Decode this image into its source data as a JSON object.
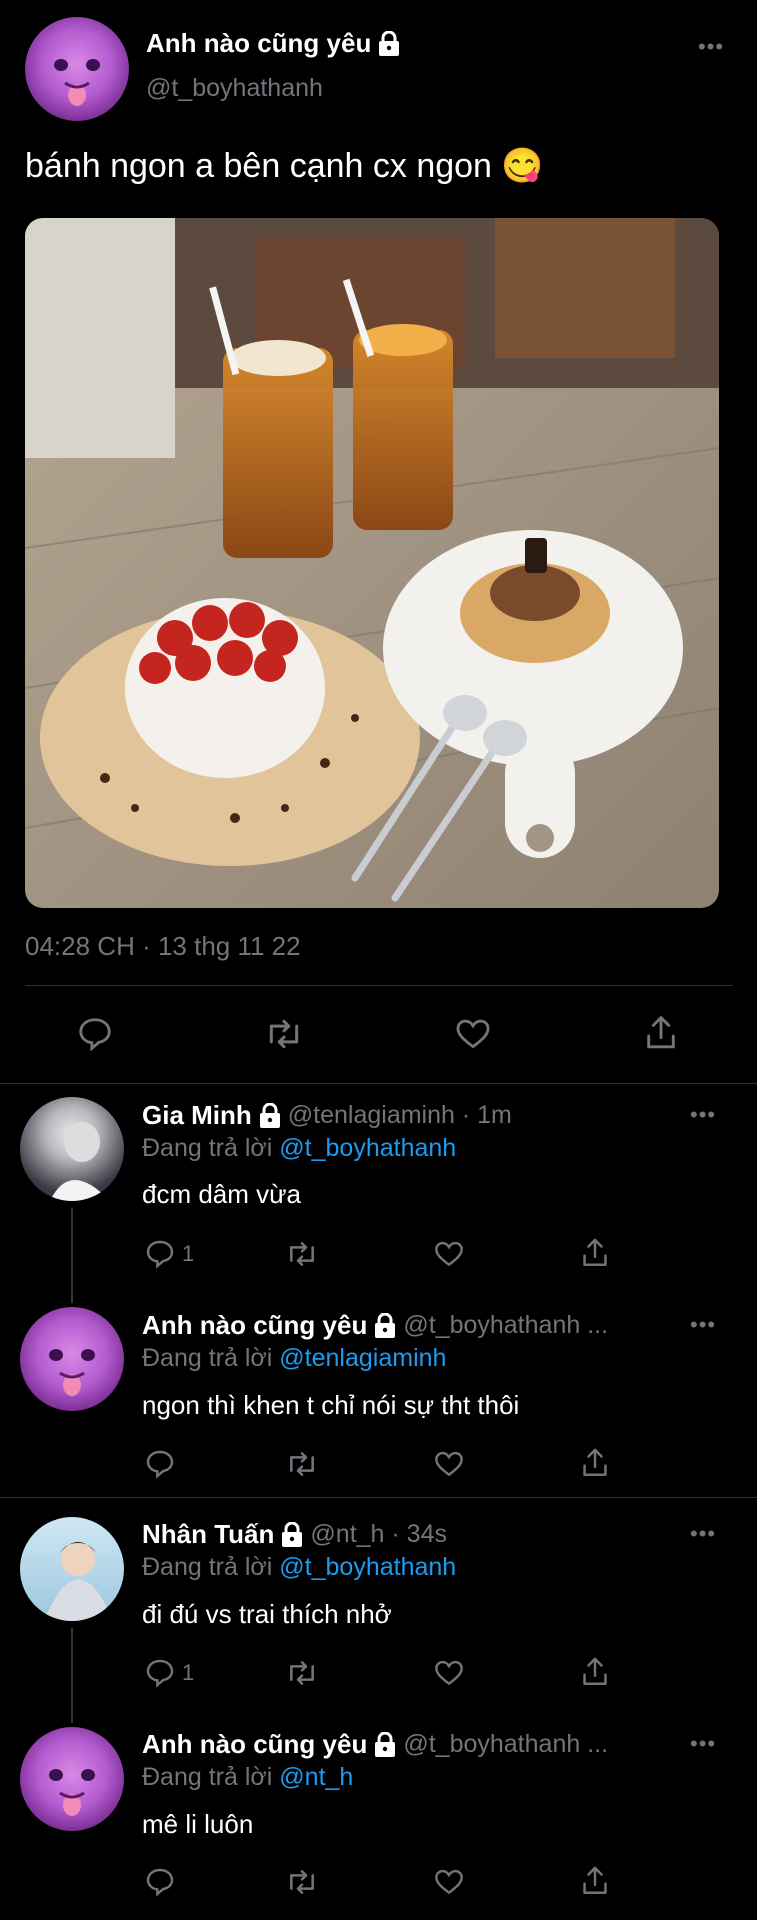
{
  "main_tweet": {
    "display_name": "Anh nào cũng yêu",
    "handle": "@t_boyhathanh",
    "text": "bánh ngon a bên cạnh cx ngon 😋",
    "timestamp": "04:28 CH · 13 thg 11 22",
    "icons": [
      "reply-icon",
      "retweet-icon",
      "like-icon",
      "share-icon"
    ]
  },
  "replies": [
    {
      "display_name": "Gia Minh",
      "handle": "@tenlagiaminh · 1m",
      "replying_prefix": "Đang trả lời",
      "replying_to": "@t_boyhathanh",
      "text": "đcm dâm vừa",
      "reply_count": "1"
    },
    {
      "display_name": "Anh nào cũng yêu",
      "handle": "@t_boyhathanh ...",
      "replying_prefix": "Đang trả lời",
      "replying_to": "@tenlagiaminh",
      "text": "ngon thì khen t chỉ nói sự tht thôi",
      "reply_count": ""
    },
    {
      "display_name": "Nhân Tuấn",
      "handle": "@nt_h · 34s",
      "replying_prefix": "Đang trả lời",
      "replying_to": "@t_boyhathanh",
      "text": "đi đú vs trai thích nhở",
      "reply_count": "1"
    },
    {
      "display_name": "Anh nào cũng yêu",
      "handle": "@t_boyhathanh ...",
      "replying_prefix": "Đang trả lời",
      "replying_to": "@nt_h",
      "text": "mê li luôn",
      "reply_count": ""
    }
  ],
  "colors": {
    "background": "#000000",
    "text": "#e7e9ea",
    "muted": "#71767b",
    "link": "#1d9bf0",
    "divider": "#2f3336"
  }
}
